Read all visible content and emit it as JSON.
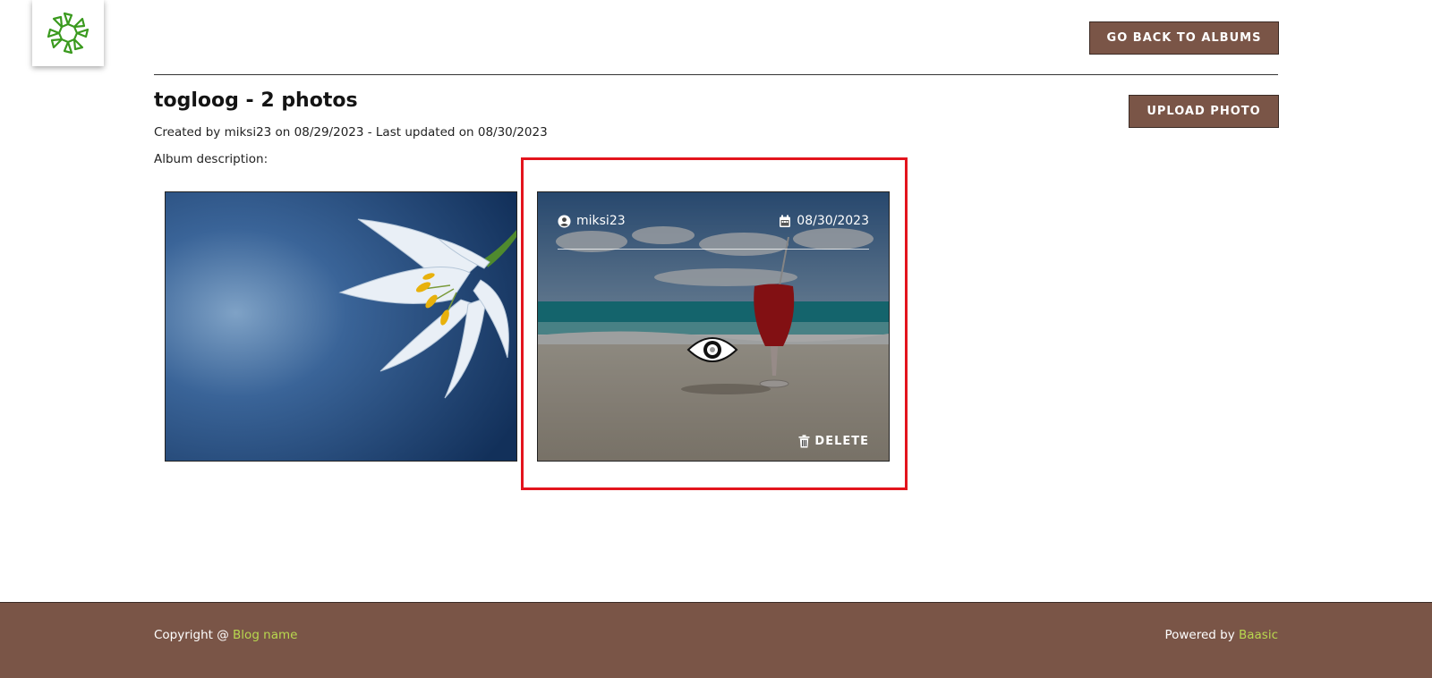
{
  "header": {
    "back_button": "GO BACK TO ALBUMS"
  },
  "album": {
    "title": "togloog - 2 photos",
    "meta": "Created by miksi23 on 08/29/2023 - Last updated on 08/30/2023",
    "description_label": "Album description:",
    "upload_button": "UPLOAD PHOTO"
  },
  "photos": [
    {
      "subject": "white lily on blue background"
    },
    {
      "subject": "red cocktail on beach",
      "author": "miksi23",
      "date": "08/30/2023",
      "delete_label": "DELETE"
    }
  ],
  "footer": {
    "copyright_prefix": "Copyright @ ",
    "blog_name": "Blog name",
    "powered_prefix": "Powered by ",
    "powered_link": "Baasic"
  },
  "colors": {
    "brand_brown": "#7a5547",
    "link_green": "#b8d84f",
    "highlight_red": "#e3141d"
  },
  "icons": [
    "logo-icon",
    "user-icon",
    "calendar-icon",
    "eye-icon",
    "trash-icon"
  ]
}
